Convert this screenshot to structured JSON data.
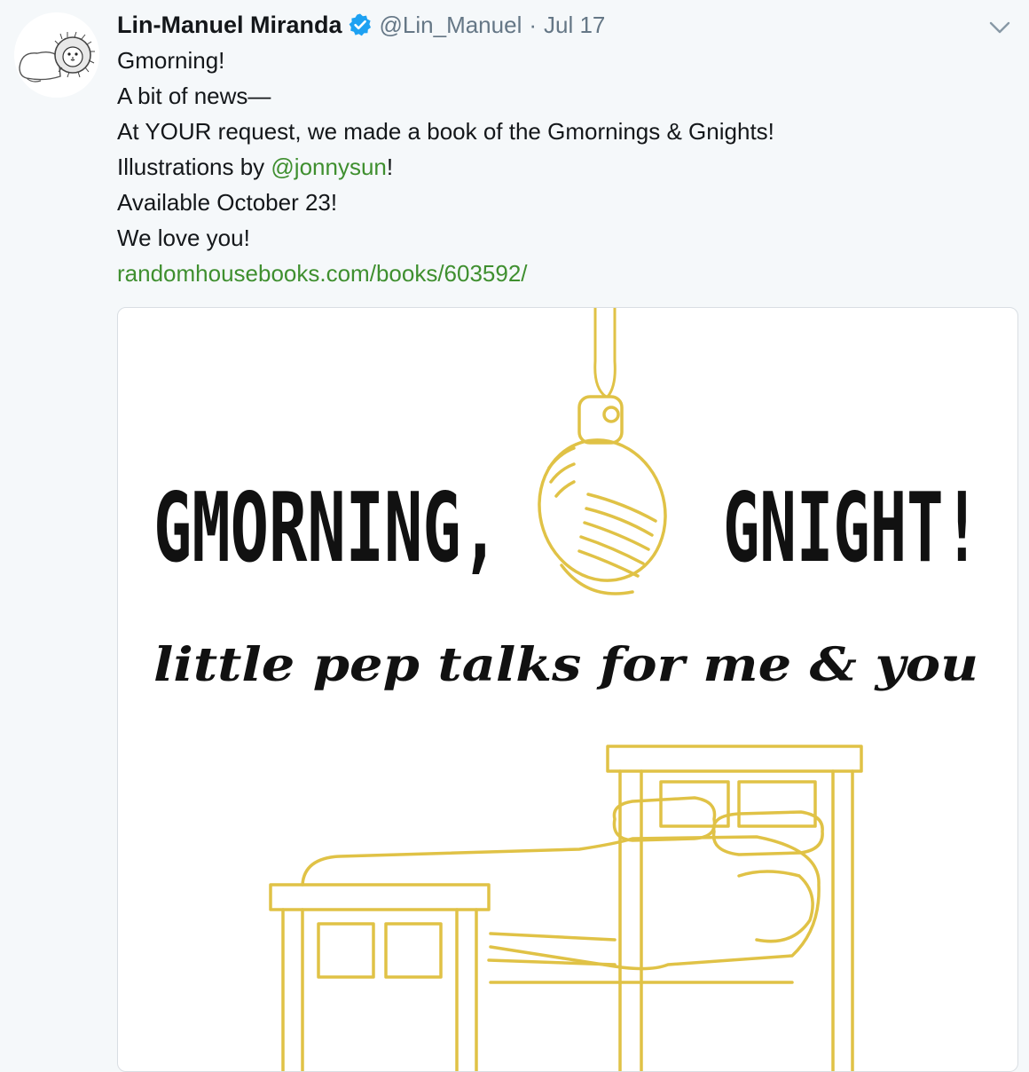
{
  "tweet": {
    "author_name": "Lin-Manuel Miranda",
    "handle": "@Lin_Manuel",
    "separator": "·",
    "date": "Jul 17",
    "text": {
      "line1": "Gmorning!",
      "line2": "A bit of news—",
      "line3": "At YOUR request, we made a book of the Gmornings & Gnights!",
      "line4_prefix": "Illustrations by ",
      "line4_mention": "@jonnysun",
      "line4_suffix": "!",
      "line5": "Available October 23!",
      "line6": "We love you!",
      "link": "randomhousebooks.com/books/603592/"
    },
    "media": {
      "title_left": "GMORNING,",
      "title_right": "GNIGHT!",
      "subtitle": "little pep talks for me & you"
    }
  },
  "colors": {
    "background": "#f5f8fa",
    "text": "#14171a",
    "secondary": "#657786",
    "link": "#3f8f2f",
    "verified": "#1da1f2",
    "illustration_gold": "#e0c246"
  },
  "icons": {
    "verified": "verified-badge-icon",
    "caret": "chevron-down-icon",
    "avatar": "lion-avatar"
  }
}
